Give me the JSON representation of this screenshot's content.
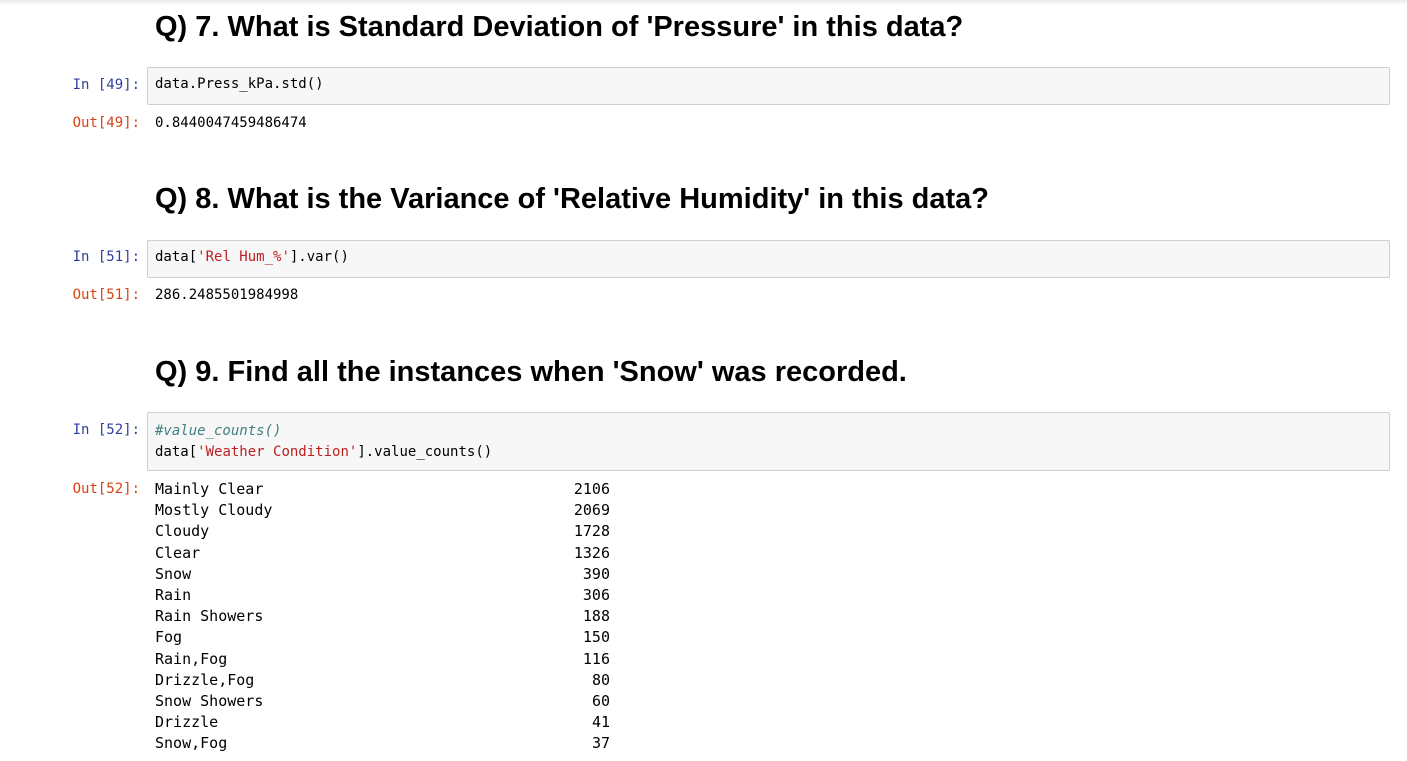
{
  "cells": {
    "q7": {
      "heading": "Q) 7. What is Standard Deviation of 'Pressure' in this data?",
      "in_prompt": "In [49]:",
      "code": "data.Press_kPa.std()",
      "out_prompt": "Out[49]:",
      "output": "0.8440047459486474"
    },
    "q8": {
      "heading": "Q) 8. What is the Variance of 'Relative Humidity' in this data?",
      "in_prompt": "In [51]:",
      "code_prefix": "data[",
      "code_string": "'Rel Hum_%'",
      "code_suffix": "].var()",
      "out_prompt": "Out[51]:",
      "output": "286.2485501984998"
    },
    "q9": {
      "heading": "Q) 9. Find all the instances when 'Snow' was recorded.",
      "in_prompt": "In [52]:",
      "code_comment": "#value_counts()",
      "code_prefix": "data[",
      "code_string": "'Weather Condition'",
      "code_suffix": "].value_counts()",
      "out_prompt": "Out[52]:",
      "value_counts": [
        {
          "label": "Mainly Clear",
          "count": "2106"
        },
        {
          "label": "Mostly Cloudy",
          "count": "2069"
        },
        {
          "label": "Cloudy",
          "count": "1728"
        },
        {
          "label": "Clear",
          "count": "1326"
        },
        {
          "label": "Snow",
          "count": "390"
        },
        {
          "label": "Rain",
          "count": "306"
        },
        {
          "label": "Rain Showers",
          "count": "188"
        },
        {
          "label": "Fog",
          "count": "150"
        },
        {
          "label": "Rain,Fog",
          "count": "116"
        },
        {
          "label": "Drizzle,Fog",
          "count": "80"
        },
        {
          "label": "Snow Showers",
          "count": "60"
        },
        {
          "label": "Drizzle",
          "count": "41"
        },
        {
          "label": "Snow,Fog",
          "count": "37"
        }
      ]
    }
  },
  "colors": {
    "in_prompt": "#303f9f",
    "out_prompt": "#d84315",
    "string": "#ba2121",
    "comment": "#408080",
    "cell_bg": "#f7f7f7",
    "cell_border": "#cfcfcf"
  }
}
